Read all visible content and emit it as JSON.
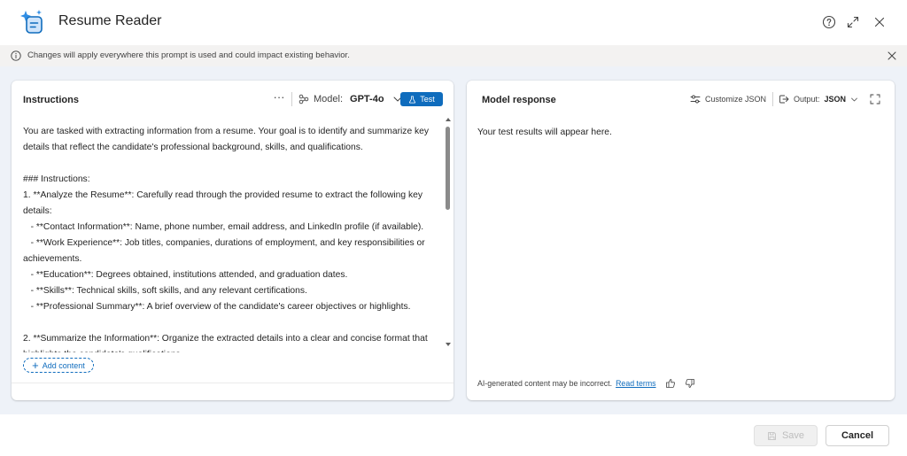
{
  "header": {
    "title": "Resume Reader",
    "icons": [
      "sparkle-document-icon",
      "help-icon",
      "expand-icon",
      "close-icon"
    ]
  },
  "banner": {
    "text": "Changes will apply everywhere this prompt is used and could impact existing behavior."
  },
  "instructions_panel": {
    "title": "Instructions",
    "more_label": "···",
    "model_label": "Model:",
    "model_value": "GPT-4o",
    "test_label": "Test",
    "body": "You are tasked with extracting information from a resume. Your goal is to identify and summarize key details that reflect the candidate's professional background, skills, and qualifications.\n\n### Instructions:\n1. **Analyze the Resume**: Carefully read through the provided resume to extract the following key details:\n   - **Contact Information**: Name, phone number, email address, and LinkedIn profile (if available).\n   - **Work Experience**: Job titles, companies, durations of employment, and key responsibilities or achievements.\n   - **Education**: Degrees obtained, institutions attended, and graduation dates.\n   - **Skills**: Technical skills, soft skills, and any relevant certifications.\n   - **Professional Summary**: A brief overview of the candidate's career objectives or highlights.\n\n2. **Summarize the Information**: Organize the extracted details into a clear and concise format that highlights the candidate's qualifications.",
    "add_content_label": "Add content"
  },
  "response_panel": {
    "title": "Model response",
    "customize_label": "Customize JSON",
    "output_label": "Output:",
    "output_value": "JSON",
    "placeholder": "Your test results will appear here.",
    "disclaimer": "AI-generated content may be incorrect.",
    "read_terms": "Read terms"
  },
  "footer": {
    "save_label": "Save",
    "cancel_label": "Cancel"
  },
  "colors": {
    "accent": "#0f6cbd",
    "banner_bg": "#f3f2f1",
    "content_bg": "#eef2f8"
  }
}
